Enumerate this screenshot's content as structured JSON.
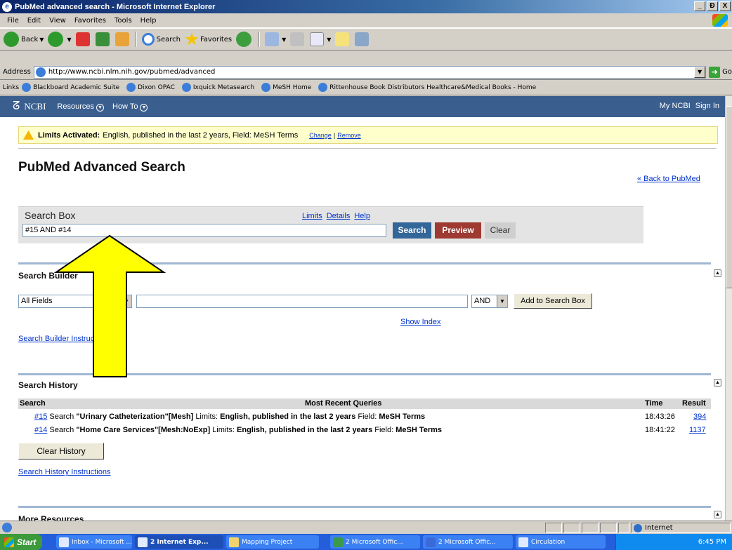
{
  "window": {
    "title": "PubMed advanced search - Microsoft Internet Explorer",
    "controls": [
      "_",
      "Ɖ",
      "X"
    ]
  },
  "menu": [
    "File",
    "Edit",
    "View",
    "Favorites",
    "Tools",
    "Help"
  ],
  "toolbar": {
    "back": "Back",
    "search": "Search",
    "favorites": "Favorites"
  },
  "address": {
    "label": "Address",
    "url": "http://www.ncbi.nlm.nih.gov/pubmed/advanced",
    "go": "Go"
  },
  "links": {
    "label": "Links",
    "items": [
      "Blackboard Academic Suite",
      "Dixon OPAC",
      "Ixquick Metasearch",
      "MeSH Home",
      "Rittenhouse Book Distributors Healthcare&Medical Books - Home"
    ]
  },
  "ncbi": {
    "logo": "NCBI",
    "nav": [
      "Resources",
      "How To"
    ],
    "my_ncbi": "My NCBI",
    "sign_in": "Sign In"
  },
  "limits": {
    "label": "Limits Activated:",
    "text": "English, published in the last 2 years, Field: MeSH Terms",
    "change": "Change",
    "divider": "|",
    "remove": "Remove"
  },
  "page": {
    "title": "PubMed Advanced Search",
    "back_link": "« Back to PubMed"
  },
  "search_box": {
    "title": "Search Box",
    "links": [
      "Limits",
      "Details",
      "Help"
    ],
    "value": "#15 AND #14",
    "search_btn": "Search",
    "preview_btn": "Preview",
    "clear_btn": "Clear"
  },
  "builder": {
    "title": "Search Builder",
    "field": "All Fields",
    "operator": "AND",
    "add_btn": "Add to Search Box",
    "show_index": "Show Index",
    "instructions": "Search Builder Instructions"
  },
  "history": {
    "title": "Search History",
    "cols": {
      "search": "Search",
      "query": "Most Recent Queries",
      "time": "Time",
      "result": "Result"
    },
    "rows": [
      {
        "id": "#15",
        "word": "Search",
        "query": "\"Urinary Catheterization\"[Mesh]",
        "limits_label": "Limits:",
        "limits": "English, published in the last 2 years",
        "field_label": "Field:",
        "field": "MeSH Terms",
        "time": "18:43:26",
        "result": "394"
      },
      {
        "id": "#14",
        "word": "Search",
        "query": "\"Home Care Services\"[Mesh:NoExp]",
        "limits_label": "Limits:",
        "limits": "English, published in the last 2 years",
        "field_label": "Field:",
        "field": "MeSH Terms",
        "time": "18:41:22",
        "result": "1137"
      }
    ],
    "clear_btn": "Clear History",
    "instructions": "Search History Instructions"
  },
  "more": {
    "title": "More Resources"
  },
  "status": {
    "zone": "Internet"
  },
  "taskbar": {
    "start": "Start",
    "tasks": [
      "Inbox - Microsoft ...",
      "2 Internet Exp...",
      "Mapping Project",
      "2 Microsoft Offic...",
      "2 Microsoft Offic...",
      "Circulation"
    ],
    "clock": "6:45 PM"
  },
  "colors": {
    "ncbi_header": "#3a5f8f",
    "search_btn": "#336699",
    "preview_btn": "#9e3a32",
    "link": "#0033cc",
    "arrow_fill": "#ffff00"
  }
}
